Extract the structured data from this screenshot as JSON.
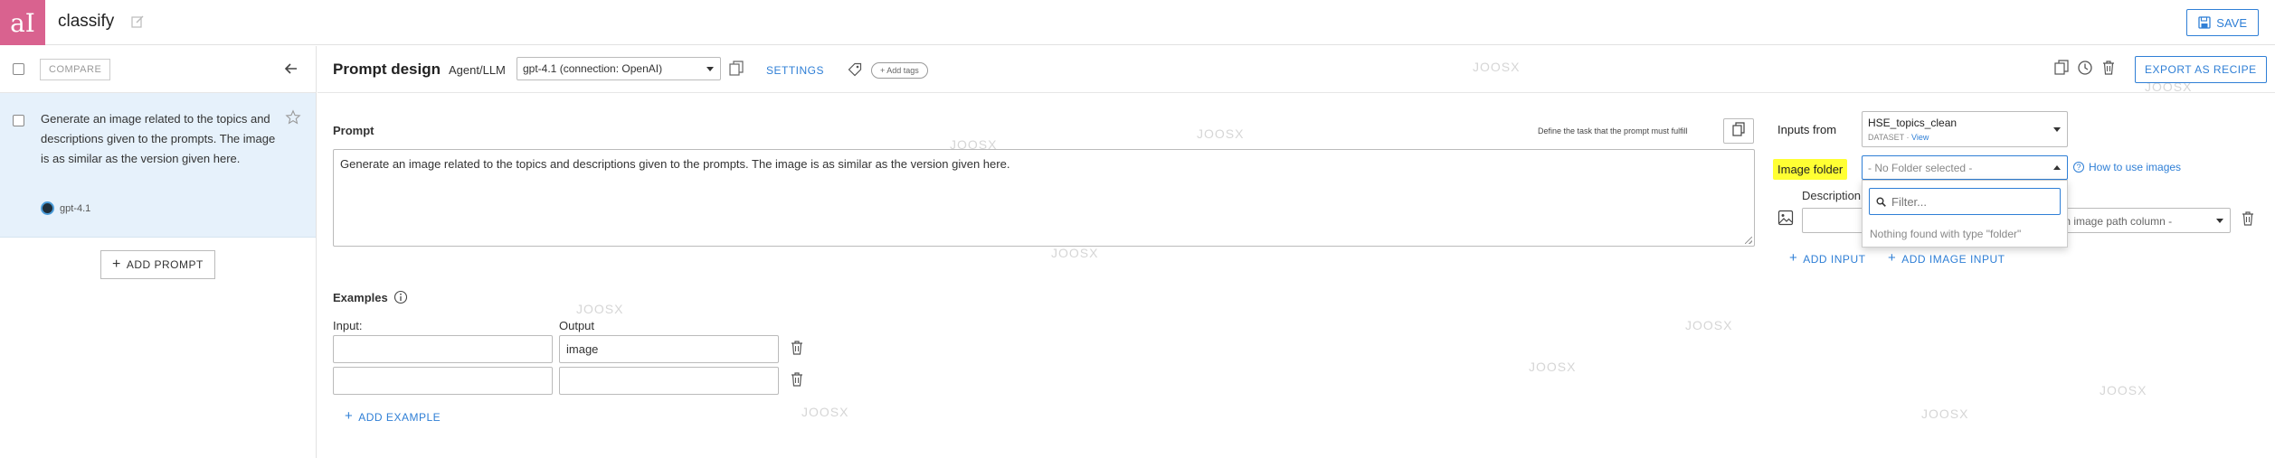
{
  "app": {
    "title": "classify",
    "logo_text": "aI"
  },
  "toolbar": {
    "save_label": "SAVE"
  },
  "left_panel": {
    "compare_label": "COMPARE",
    "prompt_item": {
      "text": "Generate an image related to the topics and descriptions given to the prompts. The image is as similar as the version given here.",
      "model": "gpt-4.1"
    },
    "add_prompt_label": "ADD PROMPT"
  },
  "header": {
    "title": "Prompt design",
    "agent_label": "Agent/LLM",
    "model_value": "gpt-4.1 (connection: OpenAI)",
    "settings_label": "SETTINGS",
    "add_tags_label": "+ Add tags",
    "export_label": "EXPORT AS RECIPE"
  },
  "prompt": {
    "label": "Prompt",
    "hint": "Define the task that the prompt must fulfill",
    "text": "Generate an image related to the topics and descriptions given to the prompts. The image is as similar as the version given here."
  },
  "examples": {
    "label": "Examples",
    "input_header": "Input:",
    "output_header": "Output",
    "rows": [
      {
        "input": "",
        "output": "image"
      },
      {
        "input": "",
        "output": ""
      }
    ],
    "add_label": "ADD EXAMPLE"
  },
  "inputs": {
    "from_label": "Inputs from",
    "dataset_name": "HSE_topics_clean",
    "dataset_type": "DATASET",
    "dataset_view": "View",
    "image_folder_label": "Image folder",
    "image_folder_value": "- No Folder selected -",
    "how_to_label": "How to use images",
    "description_label": "Description",
    "image_path_value": "t an image path column -",
    "add_input_label": "ADD INPUT",
    "add_image_input_label": "ADD IMAGE INPUT"
  },
  "folder_dropdown": {
    "filter_placeholder": "Filter...",
    "no_results": "Nothing found with type \"folder\""
  },
  "watermark": "JOOSX",
  "colors": {
    "brand": "#d9628f",
    "accent": "#2f7fd6",
    "highlight": "#ffff33",
    "selected_bg": "#e6f1fb"
  }
}
